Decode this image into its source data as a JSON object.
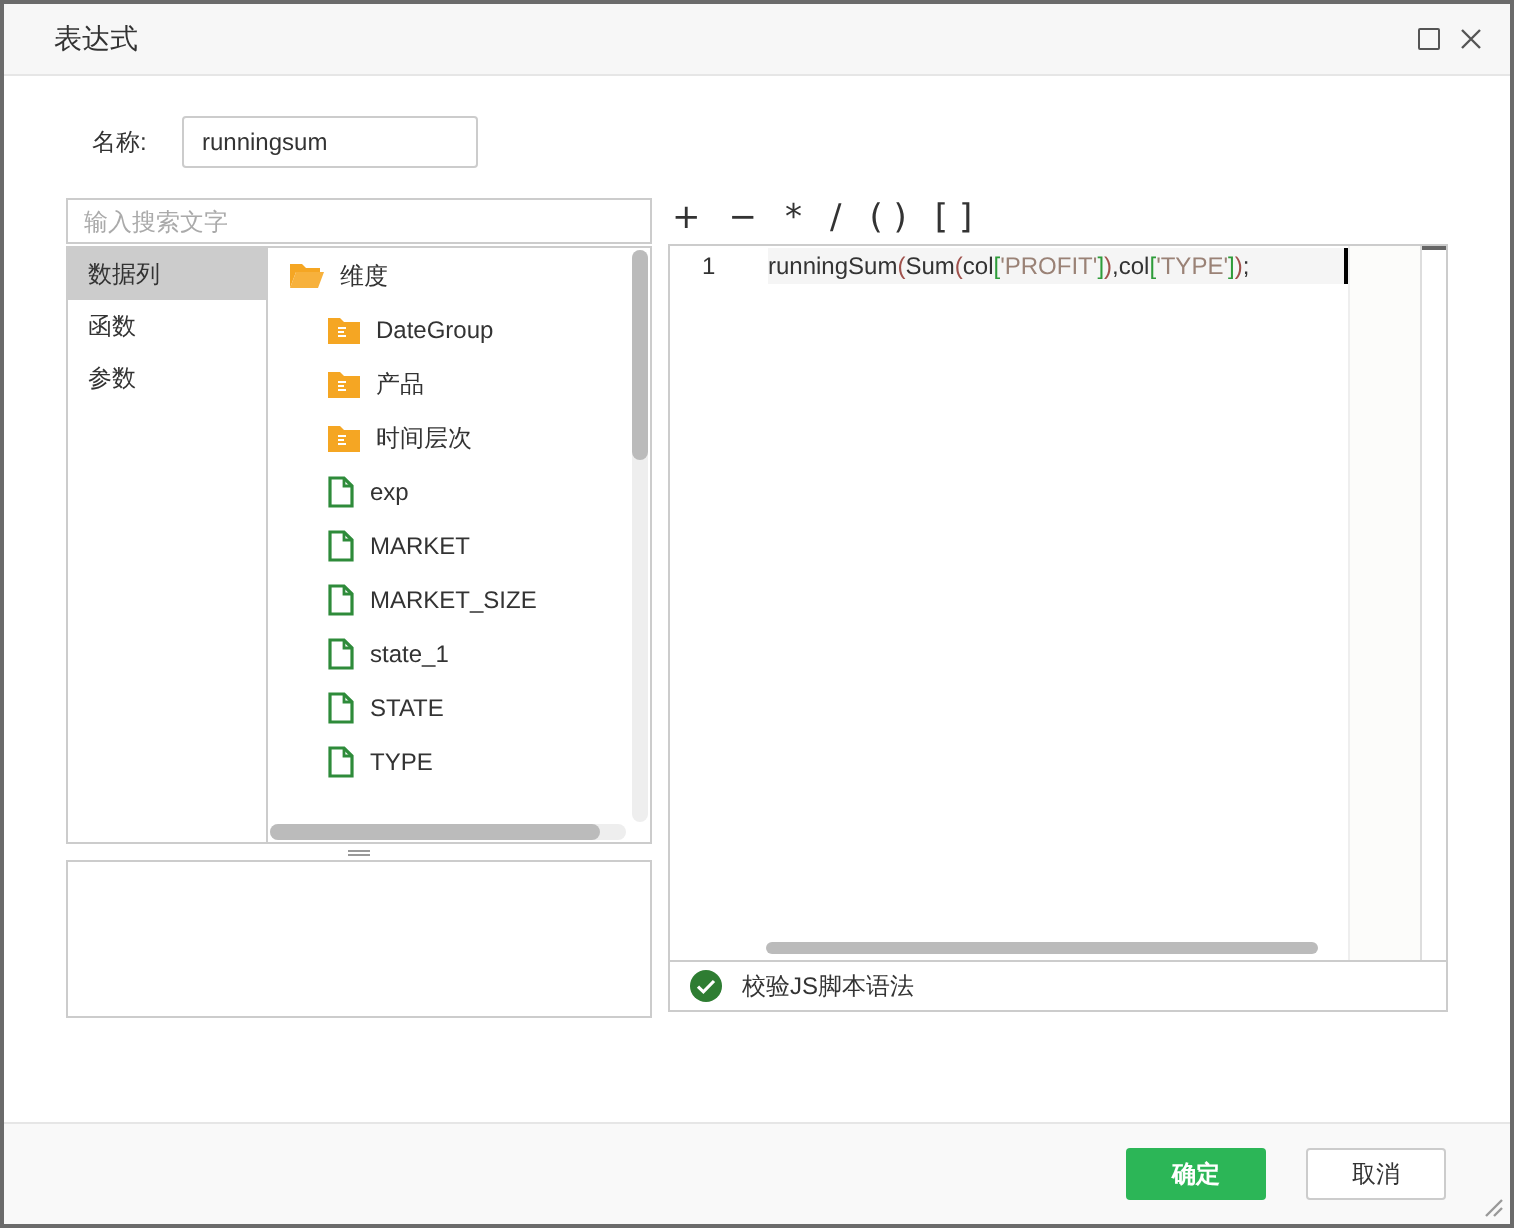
{
  "dialog": {
    "title": "表达式"
  },
  "name_field": {
    "label": "名称:",
    "value": "runningsum"
  },
  "search": {
    "placeholder": "输入搜索文字"
  },
  "categories": [
    {
      "label": "数据列",
      "selected": true
    },
    {
      "label": "函数",
      "selected": false
    },
    {
      "label": "参数",
      "selected": false
    }
  ],
  "tree": [
    {
      "label": "维度",
      "kind": "root",
      "expanded": true,
      "children": [
        {
          "label": "DateGroup",
          "kind": "folder"
        },
        {
          "label": "产品",
          "kind": "folder"
        },
        {
          "label": "时间层次",
          "kind": "folder"
        },
        {
          "label": "exp",
          "kind": "field"
        },
        {
          "label": "MARKET",
          "kind": "field"
        },
        {
          "label": "MARKET_SIZE",
          "kind": "field"
        },
        {
          "label": "state_1",
          "kind": "field"
        },
        {
          "label": "STATE",
          "kind": "field"
        },
        {
          "label": "TYPE",
          "kind": "field"
        }
      ]
    }
  ],
  "operators": [
    "+",
    "−",
    "*",
    "/",
    "( )",
    "[ ]"
  ],
  "editor": {
    "lines": [
      {
        "number": "1",
        "tokens": [
          {
            "text": "runningSum",
            "kind": "plain"
          },
          {
            "text": "(",
            "kind": "paren"
          },
          {
            "text": "Sum",
            "kind": "plain"
          },
          {
            "text": "(",
            "kind": "paren"
          },
          {
            "text": "col",
            "kind": "plain"
          },
          {
            "text": "[",
            "kind": "bracket"
          },
          {
            "text": "'PROFIT'",
            "kind": "string"
          },
          {
            "text": "]",
            "kind": "bracket"
          },
          {
            "text": ")",
            "kind": "paren"
          },
          {
            "text": ",col",
            "kind": "plain"
          },
          {
            "text": "[",
            "kind": "bracket"
          },
          {
            "text": "'TYPE'",
            "kind": "string"
          },
          {
            "text": "]",
            "kind": "bracket"
          },
          {
            "text": ")",
            "kind": "paren"
          },
          {
            "text": ";",
            "kind": "plain"
          }
        ]
      }
    ]
  },
  "validation": {
    "label": "校验JS脚本语法",
    "valid": true
  },
  "buttons": [
    {
      "label": "确定",
      "kind": "primary"
    },
    {
      "label": "取消",
      "kind": "secondary"
    }
  ]
}
